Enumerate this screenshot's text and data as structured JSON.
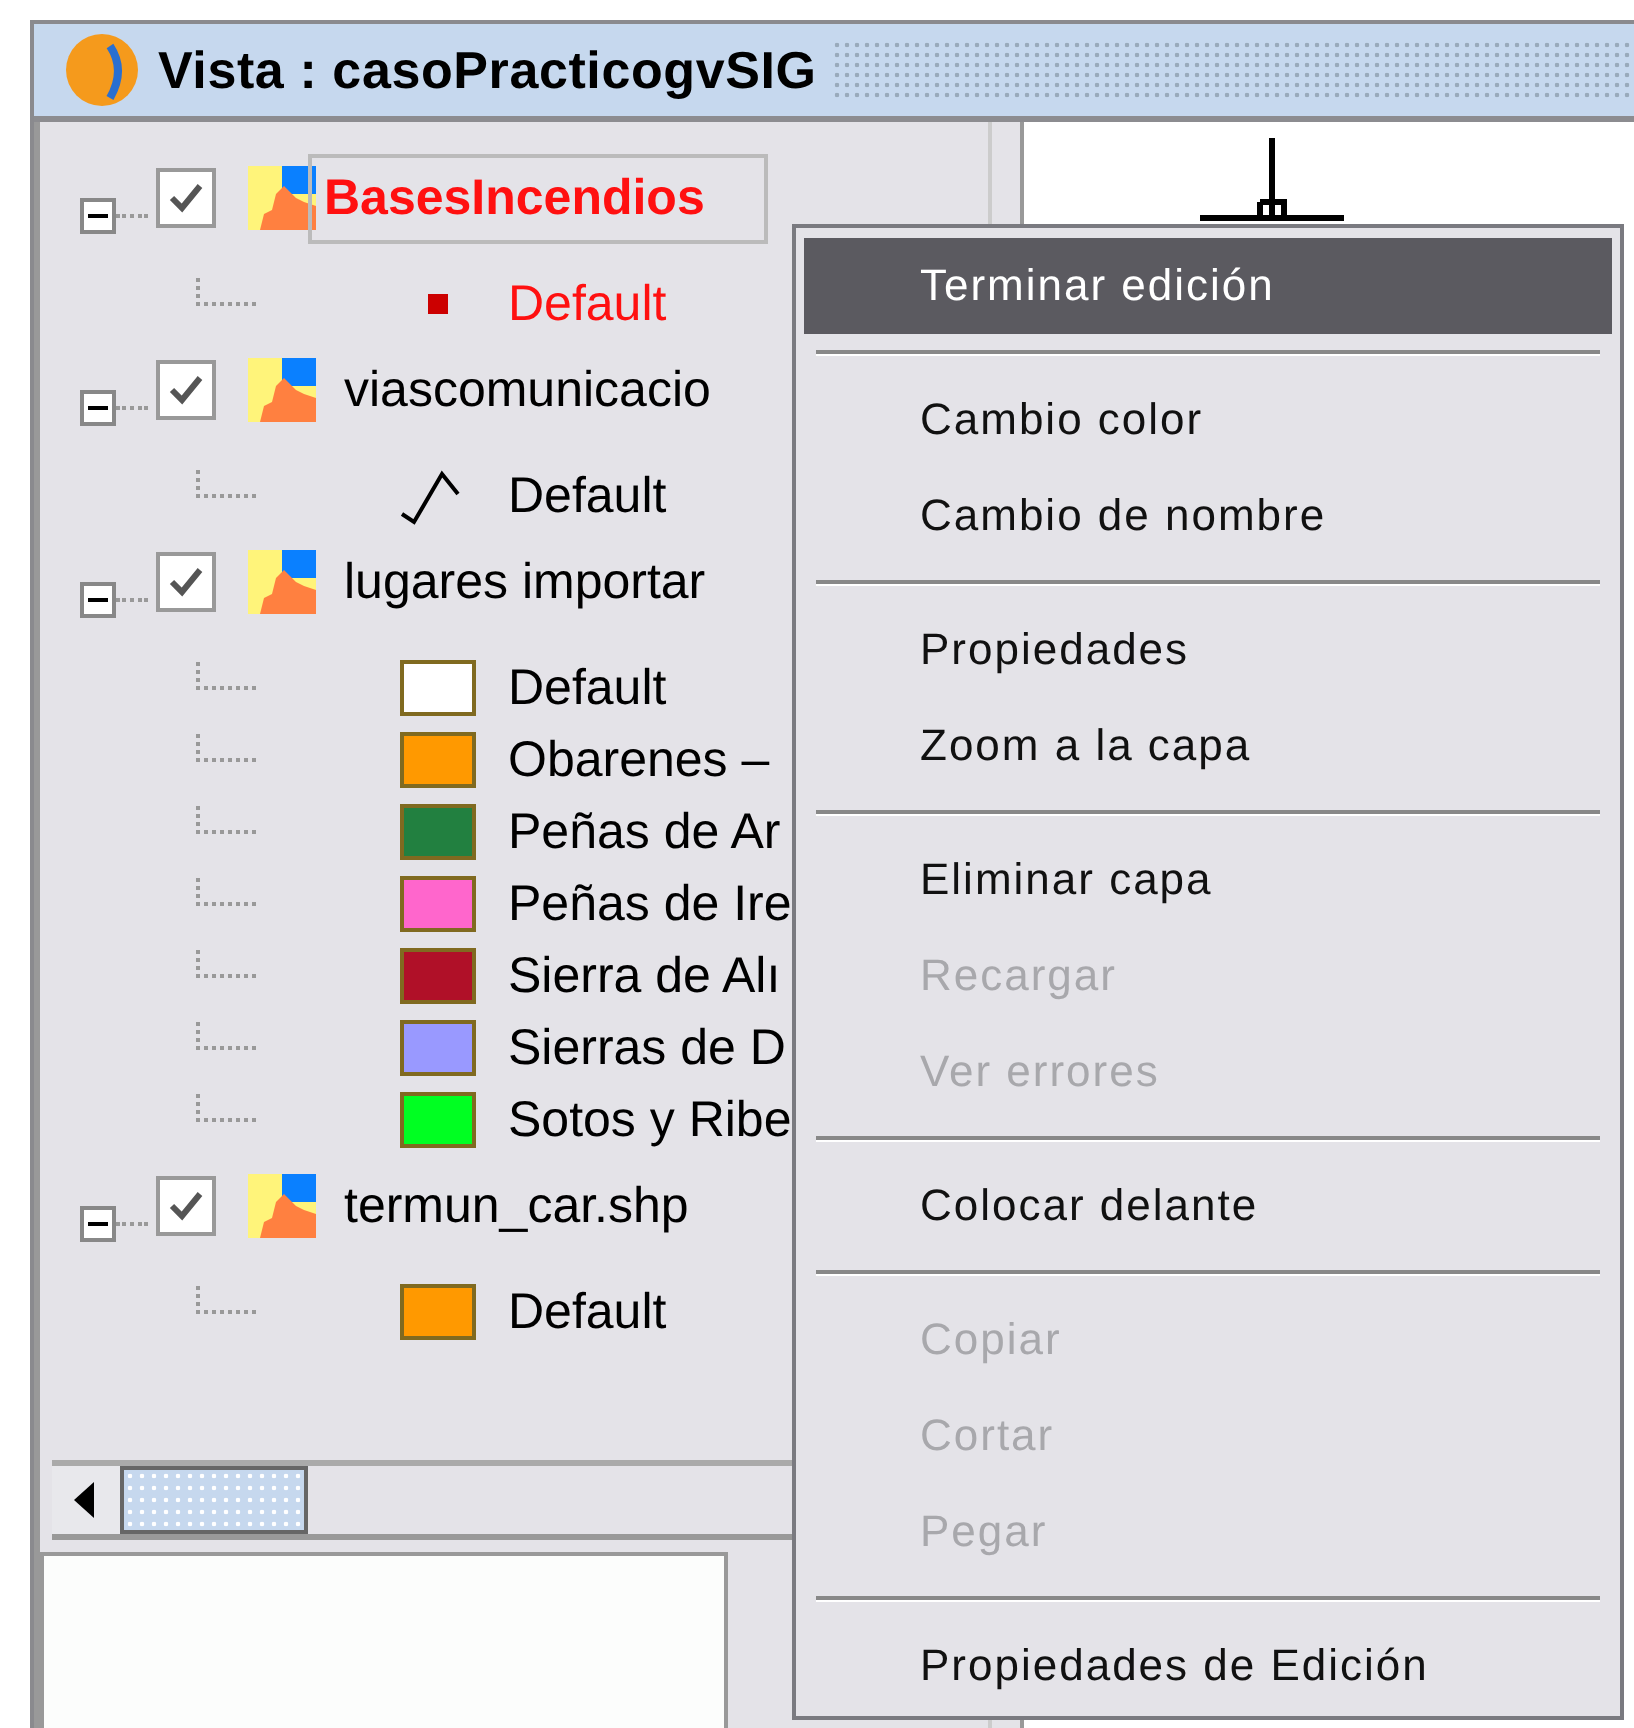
{
  "window": {
    "title": "Vista : casoPracticogvSIG"
  },
  "layers": [
    {
      "name": "BasesIncendios",
      "selected": true,
      "checked": true,
      "expanded": true,
      "symbols": [
        {
          "kind": "point",
          "label": "Default",
          "color": "#cc0000"
        }
      ]
    },
    {
      "name": "viascomunicacio",
      "selected": false,
      "checked": true,
      "expanded": true,
      "symbols": [
        {
          "kind": "line",
          "label": "Default",
          "color": "#000000"
        }
      ]
    },
    {
      "name": "lugares importar",
      "selected": false,
      "checked": true,
      "expanded": true,
      "symbols": [
        {
          "kind": "fill",
          "label": "Default",
          "color": "#ffffff"
        },
        {
          "kind": "fill",
          "label": "Obarenes –",
          "color": "#ff9900"
        },
        {
          "kind": "fill",
          "label": "Peñas de Ar",
          "color": "#228040"
        },
        {
          "kind": "fill",
          "label": "Peñas de Ire",
          "color": "#ff66cc"
        },
        {
          "kind": "fill",
          "label": "Sierra de Alı",
          "color": "#b01028"
        },
        {
          "kind": "fill",
          "label": "Sierras de D",
          "color": "#9999ff"
        },
        {
          "kind": "fill",
          "label": "Sotos y Ribe",
          "color": "#00ff22"
        }
      ]
    },
    {
      "name": "termun_car.shp",
      "selected": false,
      "checked": true,
      "expanded": true,
      "symbols": [
        {
          "kind": "fill",
          "label": "Default",
          "color": "#ff9900"
        }
      ]
    }
  ],
  "context_menu": {
    "groups": [
      {
        "items": [
          {
            "label": "Terminar edición",
            "selected": true,
            "disabled": false
          }
        ]
      },
      {
        "items": [
          {
            "label": "Cambio color",
            "selected": false,
            "disabled": false
          },
          {
            "label": "Cambio de nombre",
            "selected": false,
            "disabled": false
          }
        ]
      },
      {
        "items": [
          {
            "label": "Propiedades",
            "selected": false,
            "disabled": false
          },
          {
            "label": "Zoom a la capa",
            "selected": false,
            "disabled": false
          }
        ]
      },
      {
        "items": [
          {
            "label": "Eliminar capa",
            "selected": false,
            "disabled": false
          },
          {
            "label": "Recargar",
            "selected": false,
            "disabled": true
          },
          {
            "label": "Ver errores",
            "selected": false,
            "disabled": true
          }
        ]
      },
      {
        "items": [
          {
            "label": "Colocar delante",
            "selected": false,
            "disabled": false
          }
        ]
      },
      {
        "items": [
          {
            "label": "Copiar",
            "selected": false,
            "disabled": true
          },
          {
            "label": "Cortar",
            "selected": false,
            "disabled": true
          },
          {
            "label": "Pegar",
            "selected": false,
            "disabled": true
          }
        ]
      },
      {
        "items": [
          {
            "label": "Propiedades de Edición",
            "selected": false,
            "disabled": false
          }
        ]
      }
    ]
  }
}
